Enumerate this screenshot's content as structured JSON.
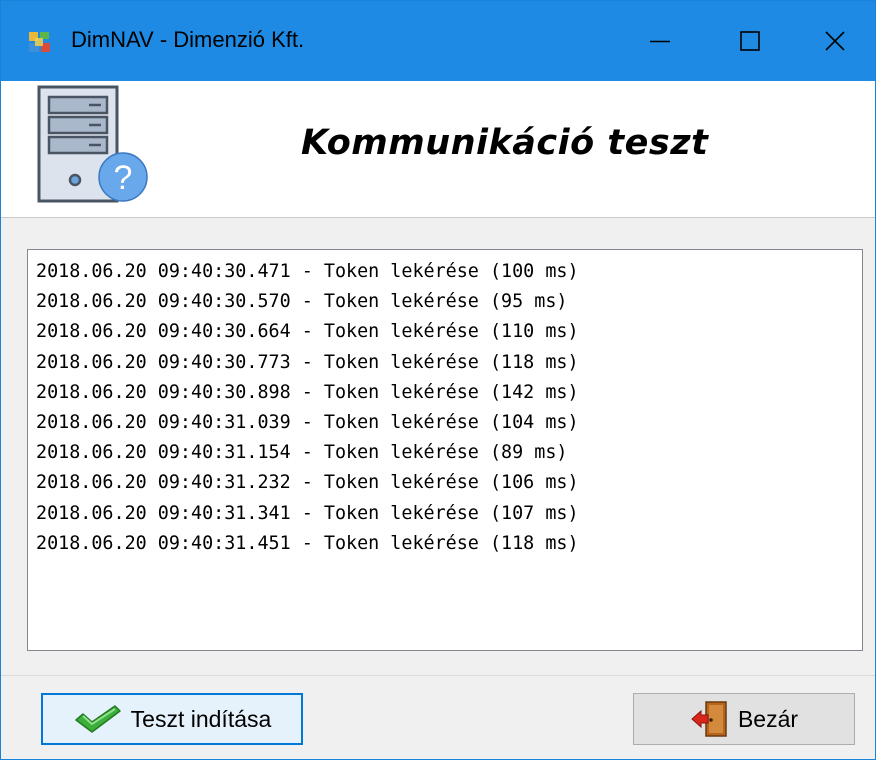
{
  "window": {
    "title": "DimNAV - Dimenzió Kft.",
    "accent_color": "#1e8ae3",
    "icons": {
      "app": "dimnav-app-icon",
      "minimize": "minimize-icon",
      "maximize": "maximize-icon",
      "close": "close-icon"
    }
  },
  "header": {
    "title": "Kommunikáció teszt",
    "icon": "server-question-icon"
  },
  "log": {
    "lines": [
      "2018.06.20 09:40:30.471 - Token lekérése (100 ms)",
      "2018.06.20 09:40:30.570 - Token lekérése (95 ms)",
      "2018.06.20 09:40:30.664 - Token lekérése (110 ms)",
      "2018.06.20 09:40:30.773 - Token lekérése (118 ms)",
      "2018.06.20 09:40:30.898 - Token lekérése (142 ms)",
      "2018.06.20 09:40:31.039 - Token lekérése (104 ms)",
      "2018.06.20 09:40:31.154 - Token lekérése (89 ms)",
      "2018.06.20 09:40:31.232 - Token lekérése (106 ms)",
      "2018.06.20 09:40:31.341 - Token lekérése (107 ms)",
      "2018.06.20 09:40:31.451 - Token lekérése (118 ms)"
    ]
  },
  "buttons": {
    "start": {
      "label": "Teszt indítása",
      "icon": "checkmark-icon"
    },
    "close": {
      "label": "Bezár",
      "icon": "exit-door-icon"
    }
  }
}
